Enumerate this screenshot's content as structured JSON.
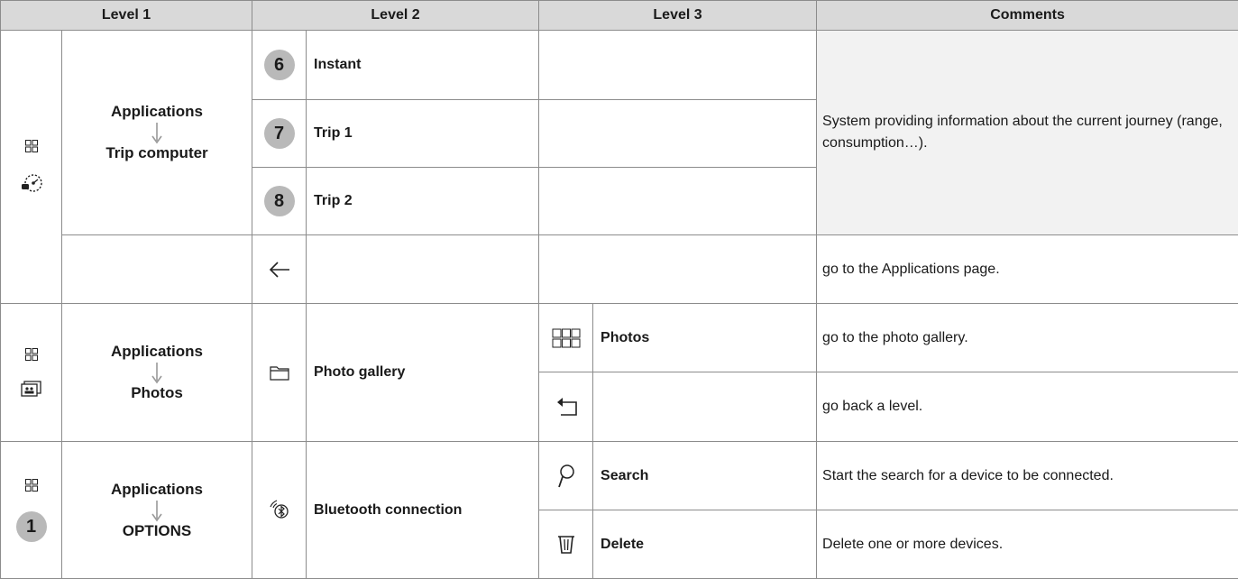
{
  "headers": {
    "level1": "Level 1",
    "level2": "Level 2",
    "level3": "Level 3",
    "comments": "Comments"
  },
  "sections": [
    {
      "level1": {
        "top": "Applications",
        "bottom": "Trip computer",
        "icons": [
          "apps-grid-icon",
          "trip-gauge-icon"
        ]
      },
      "rows": [
        {
          "badge": "6",
          "level2": "Instant",
          "level3": "",
          "comment": "System providing information about the current journey (range, consumption…)."
        },
        {
          "badge": "7",
          "level2": "Trip 1",
          "level3": ""
        },
        {
          "badge": "8",
          "level2": "Trip 2",
          "level3": ""
        },
        {
          "icon": "back-arrow-icon",
          "level2": "",
          "level3": "",
          "comment": "go to the Applications page."
        }
      ]
    },
    {
      "level1": {
        "top": "Applications",
        "bottom": "Photos",
        "icons": [
          "apps-grid-icon",
          "photos-icon"
        ]
      },
      "level2": {
        "label": "Photo gallery",
        "icon": "folder-icon"
      },
      "rows": [
        {
          "icon": "thumbnails-grid-icon",
          "level3": "Photos",
          "comment": "go to the photo gallery."
        },
        {
          "icon": "return-arrow-icon",
          "level3": "",
          "comment": "go back a level."
        }
      ]
    },
    {
      "level1": {
        "top": "Applications",
        "bottom": "OPTIONS",
        "badge": "1",
        "icons": [
          "apps-grid-icon"
        ]
      },
      "level2": {
        "label": "Bluetooth connection",
        "icon": "bluetooth-icon"
      },
      "rows": [
        {
          "icon": "search-icon",
          "level3": "Search",
          "comment": "Start the search for a device to be connected."
        },
        {
          "icon": "trash-icon",
          "level3": "Delete",
          "comment": "Delete one or more devices."
        }
      ]
    }
  ],
  "colors": {
    "header_bg": "#d9d9d9",
    "shaded_cell": "#f2f2f2",
    "badge_bg": "#b9b9b9",
    "border": "#8c8c8c"
  }
}
